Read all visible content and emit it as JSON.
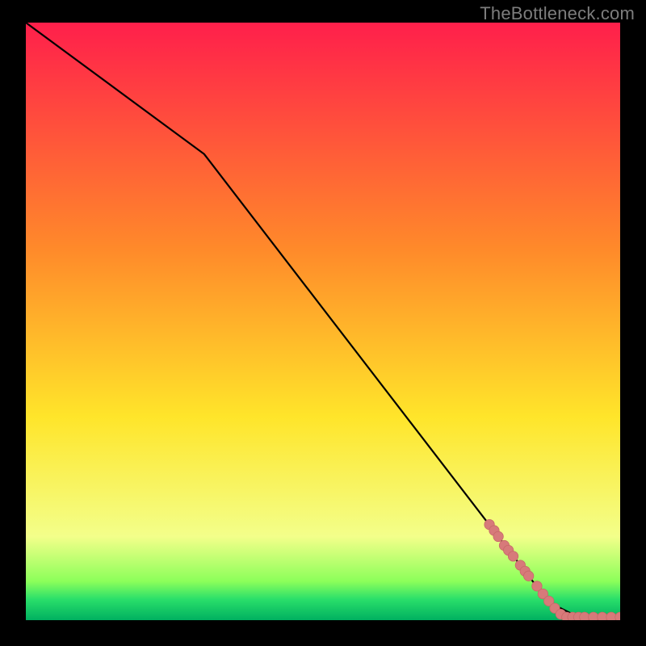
{
  "watermark": "TheBottleneck.com",
  "colors": {
    "background": "#000000",
    "line": "#000000",
    "marker_fill": "#d77a7a",
    "marker_stroke": "#c76868",
    "gradient_top": "#ff1f4b",
    "gradient_mid1": "#ff8a2a",
    "gradient_mid2": "#ffe52a",
    "gradient_low": "#f3ff8a",
    "gradient_green_top": "#8cff5a",
    "gradient_green_mid": "#2adf6a",
    "gradient_green_bottom": "#00b060"
  },
  "chart_data": {
    "type": "line",
    "title": "",
    "xlabel": "",
    "ylabel": "",
    "xlim": [
      0,
      100
    ],
    "ylim": [
      0,
      100
    ],
    "series": [
      {
        "name": "bottleneck-curve",
        "x": [
          0,
          30,
          88,
          93,
          100
        ],
        "y": [
          100,
          78,
          3,
          0.5,
          0.5
        ]
      }
    ],
    "markers": {
      "name": "highlighted-points",
      "points": [
        {
          "x": 78.0,
          "y": 16.0
        },
        {
          "x": 78.8,
          "y": 15.0
        },
        {
          "x": 79.5,
          "y": 14.0
        },
        {
          "x": 80.5,
          "y": 12.5
        },
        {
          "x": 81.2,
          "y": 11.7
        },
        {
          "x": 82.0,
          "y": 10.7
        },
        {
          "x": 83.2,
          "y": 9.2
        },
        {
          "x": 84.0,
          "y": 8.2
        },
        {
          "x": 84.6,
          "y": 7.4
        },
        {
          "x": 86.0,
          "y": 5.7
        },
        {
          "x": 87.0,
          "y": 4.4
        },
        {
          "x": 88.0,
          "y": 3.2
        },
        {
          "x": 89.0,
          "y": 2.0
        },
        {
          "x": 90.0,
          "y": 1.0
        },
        {
          "x": 91.0,
          "y": 0.5
        },
        {
          "x": 92.0,
          "y": 0.5
        },
        {
          "x": 93.0,
          "y": 0.5
        },
        {
          "x": 94.0,
          "y": 0.5
        },
        {
          "x": 95.5,
          "y": 0.5
        },
        {
          "x": 97.0,
          "y": 0.5
        },
        {
          "x": 98.5,
          "y": 0.5
        },
        {
          "x": 100.0,
          "y": 0.5
        }
      ]
    }
  }
}
